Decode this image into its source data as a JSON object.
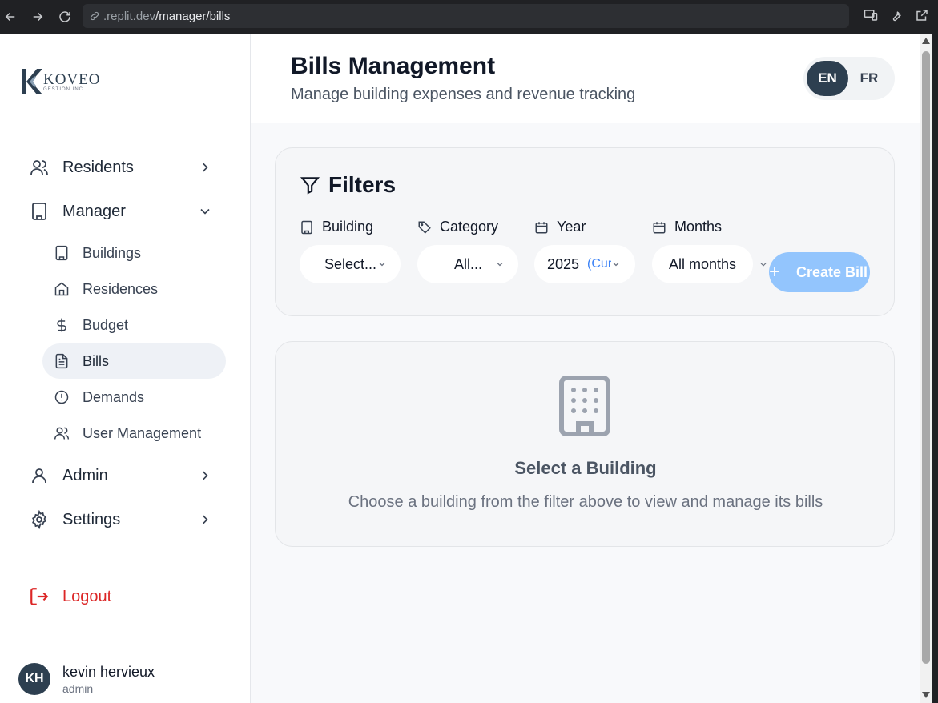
{
  "browser": {
    "url_host": ".replit.dev",
    "url_path": "/manager/bills"
  },
  "brand": {
    "name": "KOVEO",
    "tagline": "GESTION INC."
  },
  "sidebar": {
    "items": [
      {
        "label": "Residents",
        "icon": "users-icon"
      },
      {
        "label": "Manager",
        "icon": "building-icon"
      },
      {
        "label": "Admin",
        "icon": "user-icon"
      },
      {
        "label": "Settings",
        "icon": "gear-icon"
      }
    ],
    "manager_sub": [
      {
        "label": "Buildings",
        "icon": "building-icon"
      },
      {
        "label": "Residences",
        "icon": "home-icon"
      },
      {
        "label": "Budget",
        "icon": "dollar-icon"
      },
      {
        "label": "Bills",
        "icon": "document-icon",
        "active": true
      },
      {
        "label": "Demands",
        "icon": "alert-circle-icon"
      },
      {
        "label": "User Management",
        "icon": "users-icon"
      }
    ],
    "logout": "Logout"
  },
  "user": {
    "initials": "KH",
    "name": "kevin hervieux",
    "role": "admin"
  },
  "header": {
    "title": "Bills Management",
    "subtitle": "Manage building expenses and revenue tracking",
    "lang": [
      "EN",
      "FR"
    ],
    "active_lang": "EN"
  },
  "filters": {
    "title": "Filters",
    "building": {
      "label": "Building",
      "value": "Select..."
    },
    "category": {
      "label": "Category",
      "value": "All..."
    },
    "year": {
      "label": "Year",
      "value": "2025",
      "hint": "(Current)"
    },
    "months": {
      "label": "Months",
      "value": "All months"
    },
    "create_button": "Create Bill"
  },
  "empty_state": {
    "title": "Select a Building",
    "subtitle": "Choose a building from the filter above to view and manage its bills"
  },
  "colors": {
    "primary": "#2d3f50",
    "accent": "#93c5fd",
    "danger": "#dc2626"
  }
}
